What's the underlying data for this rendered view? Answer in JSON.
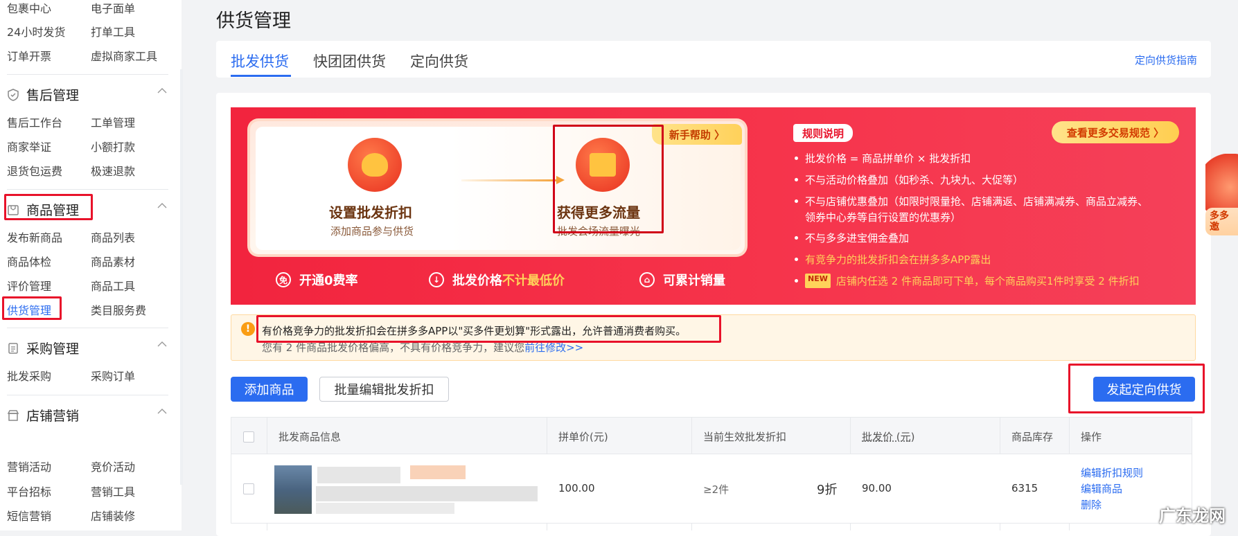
{
  "sidebar": {
    "top_items": [
      {
        "label": "包裹中心"
      },
      {
        "label": "电子面单"
      },
      {
        "label": "24小时发货"
      },
      {
        "label": "打单工具"
      },
      {
        "label": "订单开票"
      },
      {
        "label": "虚拟商家工具"
      }
    ],
    "groups": [
      {
        "title": "售后管理",
        "items": [
          {
            "label": "售后工作台"
          },
          {
            "label": "工单管理"
          },
          {
            "label": "商家举证"
          },
          {
            "label": "小额打款"
          },
          {
            "label": "退货包运费"
          },
          {
            "label": "极速退款"
          }
        ]
      },
      {
        "title": "商品管理",
        "items": [
          {
            "label": "发布新商品"
          },
          {
            "label": "商品列表"
          },
          {
            "label": "商品体检"
          },
          {
            "label": "商品素材"
          },
          {
            "label": "评价管理"
          },
          {
            "label": "商品工具"
          },
          {
            "label": "供货管理"
          },
          {
            "label": "类目服务费"
          }
        ]
      },
      {
        "title": "采购管理",
        "items": [
          {
            "label": "批发采购"
          },
          {
            "label": "采购订单"
          }
        ]
      },
      {
        "title": "店铺营销",
        "items": [
          {
            "label": "营销活动"
          },
          {
            "label": "竞价活动"
          },
          {
            "label": "平台招标"
          },
          {
            "label": "营销工具"
          },
          {
            "label": "短信营销"
          },
          {
            "label": "店铺装修"
          }
        ]
      }
    ]
  },
  "page": {
    "title": "供货管理",
    "tabs": [
      {
        "label": "批发供货"
      },
      {
        "label": "快团团供货"
      },
      {
        "label": "定向供货"
      }
    ],
    "guide_link": "定向供货指南"
  },
  "banner": {
    "help_tag": "新手帮助 〉",
    "step1_title": "设置批发折扣",
    "step1_sub": "添加商品参与供货",
    "step2_title": "获得更多流量",
    "step2_sub": "批发会场流量曝光",
    "feature1": "开通0费率",
    "feature2_pre": "批发价格",
    "feature2_hl": "不计最低价",
    "feature3": "可累计销量",
    "feature1_icon": "免",
    "rules_tag": "规则说明",
    "more_rules": "查看更多交易规范 〉",
    "rules": [
      "批发价格 = 商品拼单价 × 批发折扣",
      "不与活动价格叠加（如秒杀、九块九、大促等）",
      "不与店铺优惠叠加（如限时限量抢、店铺满返、店铺满减券、商品立减券、",
      "领券中心券等自行设置的优惠券）",
      "不与多多进宝佣金叠加",
      "有竞争力的批发折扣会在拼多多APP露出"
    ],
    "new_tag": "NEW",
    "rule_last": "店铺内任选 2 件商品即可下单，每个商品购买1件时享受 2 件折扣",
    "side_text": "多多邀"
  },
  "notice": {
    "icon": "!",
    "line1": "有价格竞争力的批发折扣会在拼多多APP以\"买多件更划算\"形式露出，允许普通消费者购买。",
    "line2_text": "您有 2 件商品批发价格偏高，不具有价格竞争力，建议您",
    "line2_link": "前往修改>>"
  },
  "actions": {
    "add": "添加商品",
    "batch_edit": "批量编辑批发折扣",
    "directed": "发起定向供货"
  },
  "table": {
    "headers": [
      "批发商品信息",
      "拼单价(元)",
      "当前生效批发折扣",
      "批发价 (元)",
      "商品库存",
      "操作"
    ],
    "rows": [
      {
        "price": "100.00",
        "tier": "≥2件",
        "discount": "9折",
        "wholesale": "90.00",
        "stock": "6315",
        "ops": [
          "编辑折扣规则",
          "编辑商品",
          "删除"
        ]
      }
    ]
  },
  "watermark": "广东龙网",
  "colors": {
    "accent": "#2b6cf0",
    "banner_red": "#f2243e",
    "highlight_box": "#e8122a"
  }
}
